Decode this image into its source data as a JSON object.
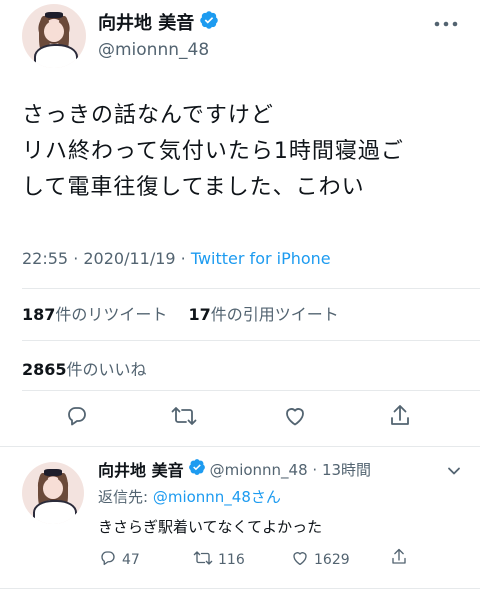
{
  "main_tweet": {
    "display_name": "向井地 美音",
    "handle": "@mionnn_48",
    "text_line_1": "さっきの話なんですけど",
    "text_line_2": "リハ終わって気付いたら1時間寝過ご",
    "text_line_3": "して電車往復してました、こわい",
    "timestamp": "22:55 · 2020/11/19 · ",
    "source": "Twitter for iPhone",
    "retweets_count": "187",
    "retweets_label": "件のリツイート",
    "quotes_count": "17",
    "quotes_label": "件の引用ツイート",
    "likes_count": "2865",
    "likes_label": "件のいいね"
  },
  "reply_tweet": {
    "display_name": "向井地 美音",
    "handle_time": "@mionnn_48 · 13時間",
    "reply_to_prefix": "返信先: ",
    "reply_to_handle": "@mionnn_48",
    "reply_to_suffix": "さん",
    "text": "きさらぎ駅着いてなくてよかった",
    "reply_count": "47",
    "retweet_count": "116",
    "like_count": "1629"
  },
  "colors": {
    "accent": "#1d9bf0",
    "text": "#0f1419",
    "muted": "#536471",
    "divider": "#e6e9eb"
  },
  "icons": [
    "verified-badge-icon",
    "more-icon",
    "reply-icon",
    "retweet-icon",
    "like-icon",
    "share-icon"
  ]
}
